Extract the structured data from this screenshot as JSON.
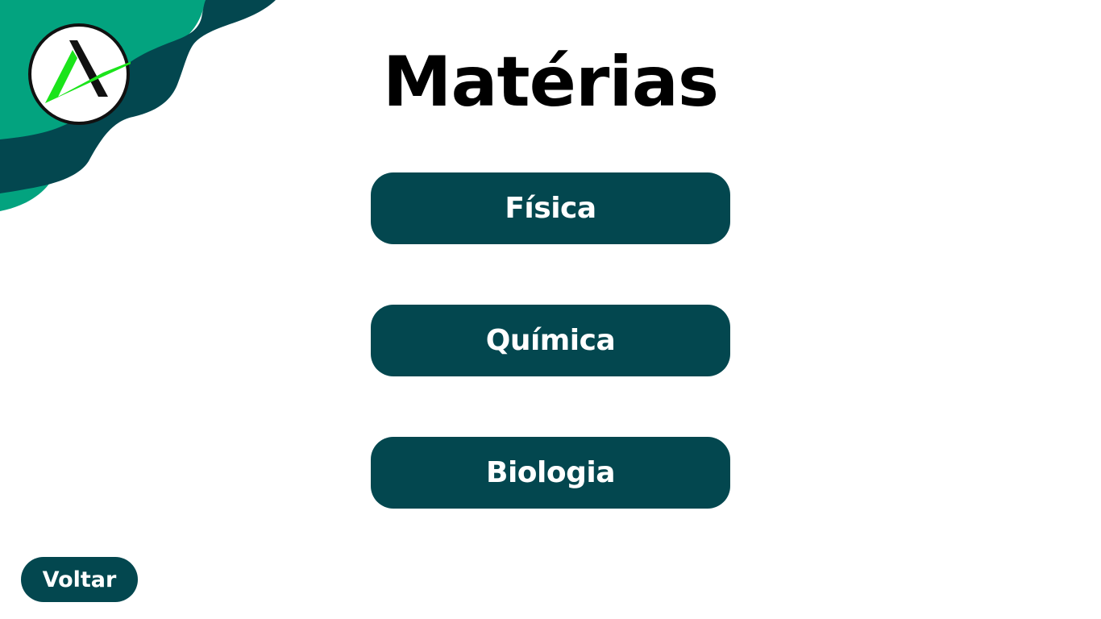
{
  "page": {
    "title": "Matérias"
  },
  "subjects": [
    {
      "label": "Física"
    },
    {
      "label": "Química"
    },
    {
      "label": "Biologia"
    }
  ],
  "navigation": {
    "back_label": "Voltar"
  },
  "logo": {
    "icon": "logo-a-check-icon"
  },
  "colors": {
    "button": "#03474f",
    "button_text": "#ffffff",
    "decor_light": "#03a37f",
    "decor_dark": "#03474f",
    "logo_accent": "#1be41b",
    "title": "#000000"
  }
}
